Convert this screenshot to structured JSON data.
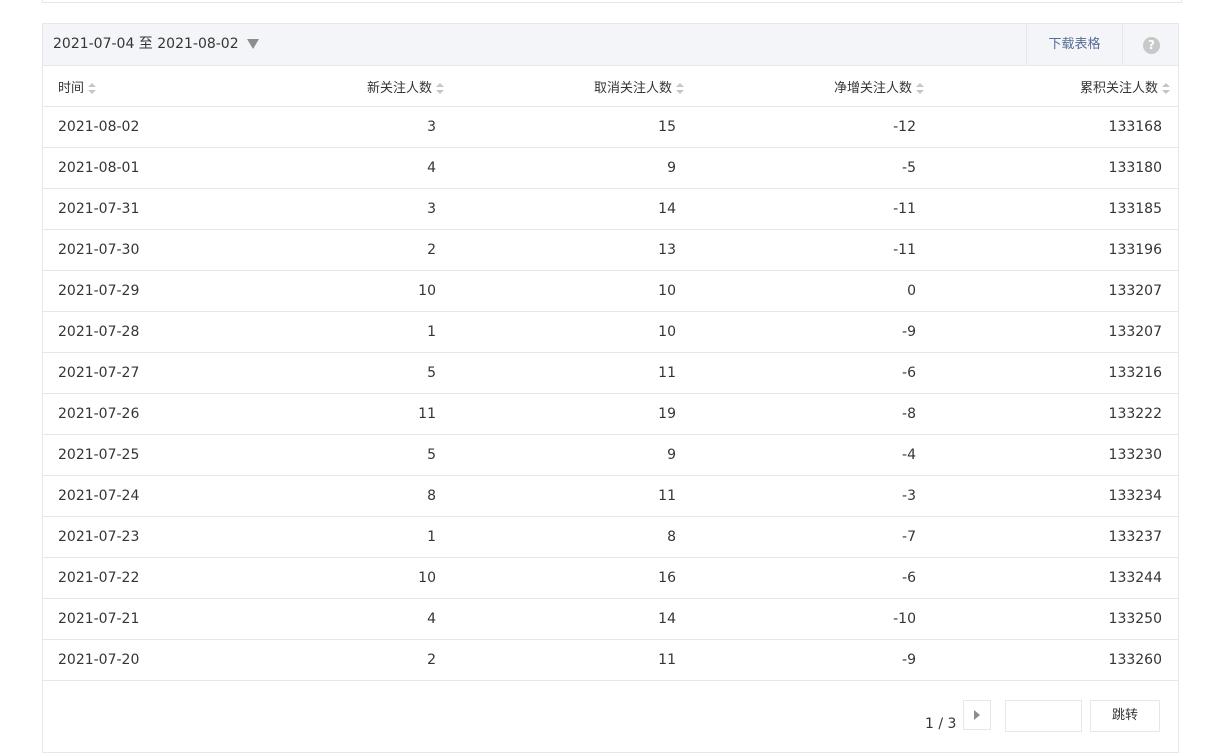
{
  "toolbar": {
    "date_range": "2021-07-04 至 2021-08-02",
    "download_label": "下载表格",
    "help_label": "?"
  },
  "table": {
    "headers": [
      "时间",
      "新关注人数",
      "取消关注人数",
      "净增关注人数",
      "累积关注人数"
    ],
    "rows": [
      [
        "2021-08-02",
        "3",
        "15",
        "-12",
        "133168"
      ],
      [
        "2021-08-01",
        "4",
        "9",
        "-5",
        "133180"
      ],
      [
        "2021-07-31",
        "3",
        "14",
        "-11",
        "133185"
      ],
      [
        "2021-07-30",
        "2",
        "13",
        "-11",
        "133196"
      ],
      [
        "2021-07-29",
        "10",
        "10",
        "0",
        "133207"
      ],
      [
        "2021-07-28",
        "1",
        "10",
        "-9",
        "133207"
      ],
      [
        "2021-07-27",
        "5",
        "11",
        "-6",
        "133216"
      ],
      [
        "2021-07-26",
        "11",
        "19",
        "-8",
        "133222"
      ],
      [
        "2021-07-25",
        "5",
        "9",
        "-4",
        "133230"
      ],
      [
        "2021-07-24",
        "8",
        "11",
        "-3",
        "133234"
      ],
      [
        "2021-07-23",
        "1",
        "8",
        "-7",
        "133237"
      ],
      [
        "2021-07-22",
        "10",
        "16",
        "-6",
        "133244"
      ],
      [
        "2021-07-21",
        "4",
        "14",
        "-10",
        "133250"
      ],
      [
        "2021-07-20",
        "2",
        "11",
        "-9",
        "133260"
      ]
    ]
  },
  "pager": {
    "page_info": "1 / 3",
    "input_value": "",
    "jump_label": "跳转"
  }
}
